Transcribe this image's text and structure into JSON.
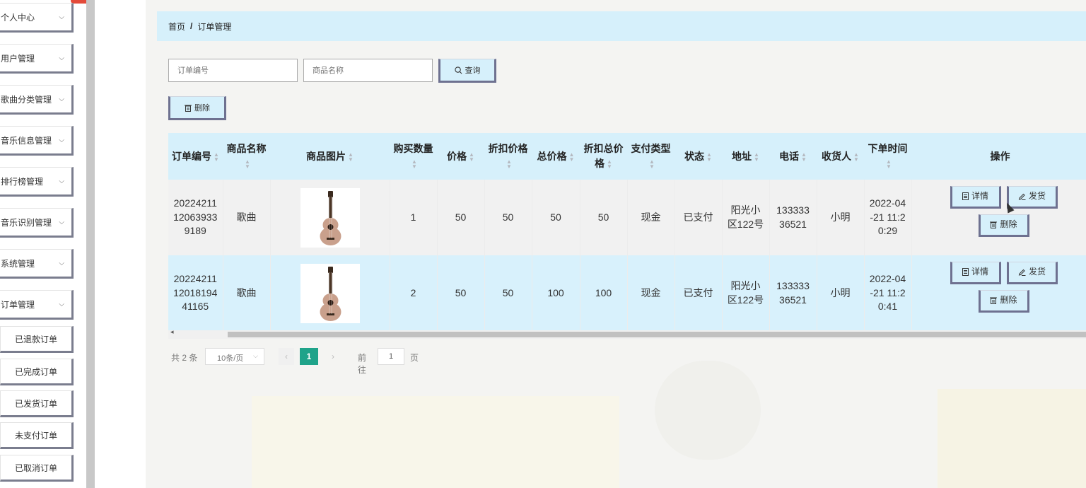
{
  "sidebar": {
    "items": [
      {
        "label": "个人中心"
      },
      {
        "label": "用户管理"
      },
      {
        "label": "歌曲分类管理"
      },
      {
        "label": "音乐信息管理"
      },
      {
        "label": "排行榜管理"
      },
      {
        "label": "音乐识别管理"
      },
      {
        "label": "系统管理"
      },
      {
        "label": "订单管理"
      }
    ],
    "sub_items": [
      {
        "label": "已退款订单"
      },
      {
        "label": "已完成订单"
      },
      {
        "label": "已发货订单"
      },
      {
        "label": "未支付订单"
      },
      {
        "label": "已取消订单"
      }
    ]
  },
  "breadcrumb": {
    "home": "首页",
    "separator": "/",
    "current": "订单管理"
  },
  "search": {
    "order_no_placeholder": "订单编号",
    "product_name_placeholder": "商品名称",
    "query_label": "查询"
  },
  "toolbar": {
    "delete_label": "删除"
  },
  "table": {
    "headers": {
      "order_no": "订单编号",
      "product_name": "商品名称",
      "product_image": "商品图片",
      "quantity": "购买数量",
      "price": "价格",
      "discount_price": "折扣价格",
      "total_price": "总价格",
      "discount_total": "折扣总价格",
      "payment_type": "支付类型",
      "status": "状态",
      "address": "地址",
      "phone": "电话",
      "receiver": "收货人",
      "order_time": "下单时间",
      "actions": "操作"
    },
    "rows": [
      {
        "order_no": "20224211120639339189",
        "product_name": "歌曲",
        "quantity": "1",
        "price": "50",
        "discount_price": "50",
        "total_price": "50",
        "discount_total": "50",
        "payment_type": "现金",
        "status": "已支付",
        "address": "阳光小区122号",
        "phone": "13333336521",
        "receiver": "小明",
        "order_time": "2022-04-21 11:20:29"
      },
      {
        "order_no": "202242111201819441165",
        "product_name": "歌曲",
        "quantity": "2",
        "price": "50",
        "discount_price": "50",
        "total_price": "100",
        "discount_total": "100",
        "payment_type": "现金",
        "status": "已支付",
        "address": "阳光小区122号",
        "phone": "13333336521",
        "receiver": "小明",
        "order_time": "2022-04-21 11:20:41"
      }
    ],
    "row_actions": {
      "detail": "详情",
      "ship": "发货",
      "delete": "删除"
    }
  },
  "pagination": {
    "total": "共 2 条",
    "page_size": "10条/页",
    "current_page": "1",
    "goto_label": "前往",
    "goto_value": "1",
    "page_suffix": "页"
  },
  "colors": {
    "accent_light": "#d6f0fb",
    "pager_active": "#1fa38a",
    "button_border": "#6e7190"
  },
  "icons": {
    "search": "search-icon",
    "delete": "trash-icon",
    "detail": "document-icon",
    "ship": "edit-icon"
  }
}
